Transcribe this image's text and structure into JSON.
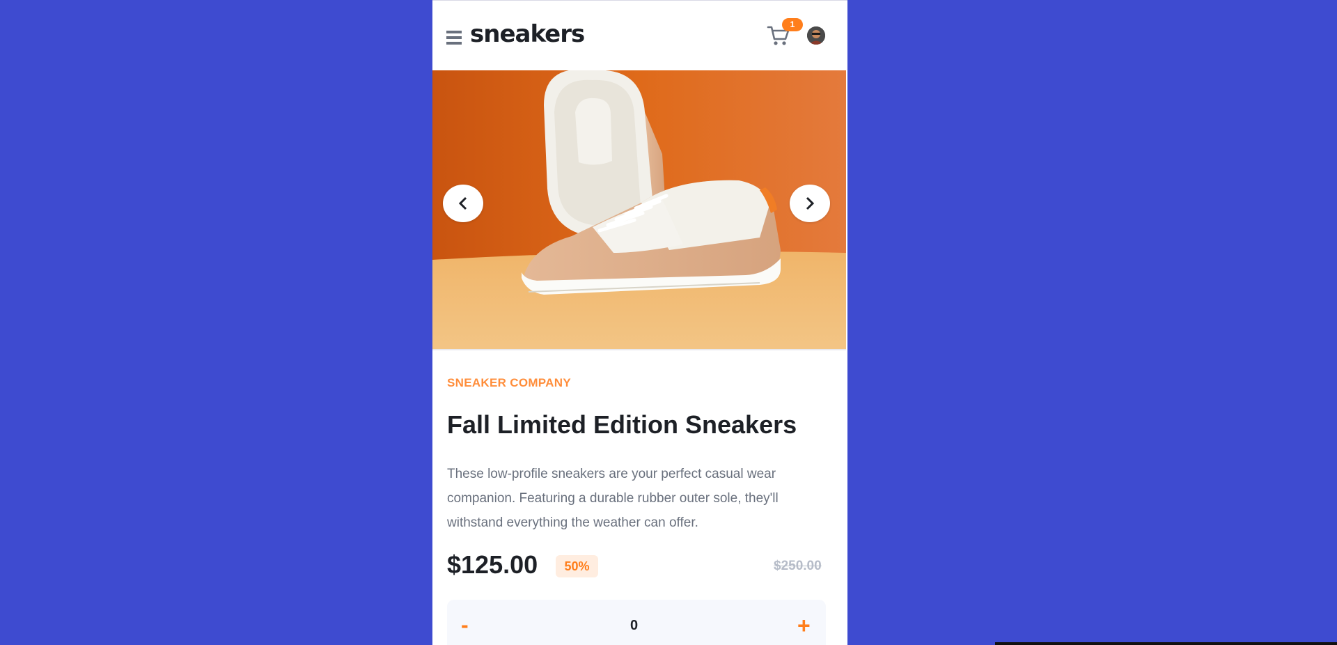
{
  "header": {
    "logo": "sneakers",
    "cart_count": "1"
  },
  "product": {
    "company": "SNEAKER COMPANY",
    "title": "Fall Limited Edition Sneakers",
    "description": "These low-profile sneakers are your perfect casual wear companion. Featuring a durable rubber outer sole, they'll withstand everything the weather can offer.",
    "price": "$125.00",
    "discount": "50%",
    "original_price": "$250.00"
  },
  "quantity": {
    "minus": "-",
    "value": "0",
    "plus": "+"
  },
  "colors": {
    "background": "#3e4bd0",
    "accent": "#ff7e1b",
    "text_dark": "#1d2026",
    "text_muted": "#69707d"
  },
  "icons": [
    "menu-icon",
    "cart-icon",
    "avatar",
    "chevron-left-icon",
    "chevron-right-icon"
  ]
}
